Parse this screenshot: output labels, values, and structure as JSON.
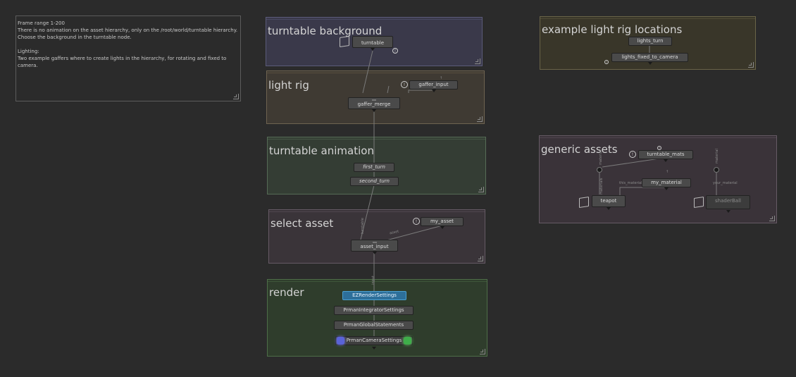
{
  "note": {
    "lines": [
      "Frame range 1-200",
      "There is no animation on the asset hierarchy, only on the /root/world/turntable hierarchy.",
      "Choose the background in the turntable node."
    ],
    "lighting_title": "Lighting:",
    "lighting_lines": [
      "Two example gaffers where to create lights in the hierarchy, for  rotating and fixed to",
      "camera."
    ]
  },
  "backdrops": {
    "turntable_background": "turntable background",
    "light_rig": "light rig",
    "turntable_animation": "turntable animation",
    "select_asset": "select asset",
    "render": "render",
    "example_light_rig_locations": "example light rig locations",
    "generic_assets": "generic assets"
  },
  "nodes": {
    "turntable": "turntable",
    "gaffer_input": "gaffer_input",
    "gaffer_merge": "gaffer_merge",
    "first_turn": "first_turn",
    "second_turn": "second_turn",
    "my_asset": "my_asset",
    "asset_input": "asset_input",
    "ezrender": "EZRenderSettings",
    "prman_integrator": "PrmanIntegratorSettings",
    "prman_global": "PrmanGlobalStatements",
    "prman_camera": "PrmanCameraSettings",
    "lights_turn": "lights_turn",
    "lights_fixed": "lights_fixed_to_camera",
    "turntable_mats": "turntable_mats",
    "my_material": "my_material",
    "teapot": "teapot",
    "shaderball": "shaderBall"
  },
  "wire_labels": {
    "asset": "asset",
    "turntable": "turntable",
    "input": "input",
    "this_material": "this_material",
    "your_material": "your_material",
    "materials": "materials",
    "geometry": "geometry",
    "material": "material"
  },
  "colors": {
    "bg": "#2b2b2b",
    "blue_node": "#2d6f9a",
    "camera_left": "#5a63d8",
    "camera_right": "#3fae4a"
  }
}
